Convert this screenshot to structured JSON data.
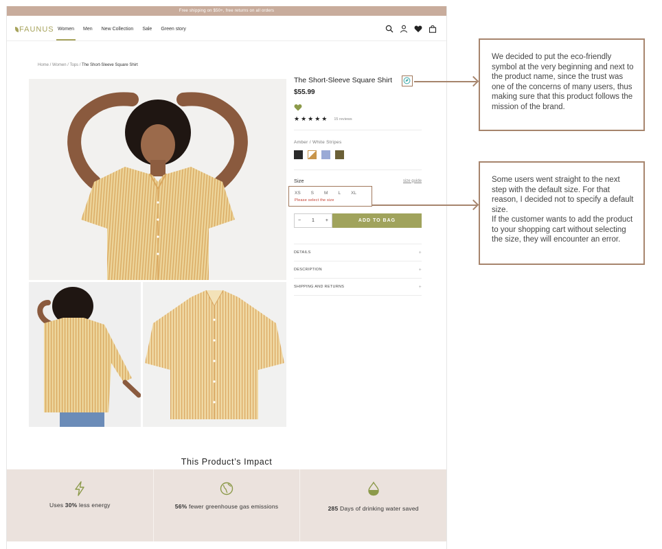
{
  "promo_bar": "Free shipping on $50+, free returns on all orders",
  "brand": "FAUNUS",
  "nav": {
    "links": [
      "Women",
      "Men",
      "New Collection",
      "Sale",
      "Green story"
    ],
    "active": "Women",
    "icons": [
      "search-icon",
      "account-icon",
      "wishlist-heart-icon",
      "bag-icon"
    ]
  },
  "breadcrumb": {
    "trail": "Home / Women / Tops /",
    "current": "The Short-Sleeve Square Shirt"
  },
  "product": {
    "title": "The Short-Sleeve Square Shirt",
    "price": "$55.99",
    "rating_stars": "★★★★★",
    "rating": 5,
    "reviews": "15 reviews",
    "color_label": "Amber / White Stripes",
    "swatches": [
      "#2a2a2a",
      "#c8954a",
      "#9aaad6",
      "#6b6037"
    ],
    "size_title": "Size",
    "size_guide": "size guide",
    "sizes": [
      "XS",
      "S",
      "M",
      "L",
      "XL"
    ],
    "size_error": "Please select the size",
    "qty_minus": "−",
    "qty_value": "1",
    "qty_plus": "+",
    "add_to_bag": "ADD TO BAG",
    "accordion": [
      "DETAILS",
      "DESCRIPTION",
      "SHIPPING AND RETURNS"
    ],
    "accordion_icon": "+"
  },
  "impact": {
    "title": "This Product’s Impact",
    "items": [
      {
        "icon": "lightning-icon",
        "pre": "Uses ",
        "bold": "30%",
        "post": " less energy"
      },
      {
        "icon": "globe-icon",
        "pre": "",
        "bold": "56%",
        "post": " fewer greenhouse gas emissions"
      },
      {
        "icon": "water-drop-icon",
        "pre": "",
        "bold": "285",
        "post": " Days of drinking water saved"
      }
    ]
  },
  "annotations": {
    "note1": "We decided to put the eco-friendly symbol at the very beginning and next to the product name, since the trust was one of the concerns of many users, thus making sure that this product follows the mission of the brand.",
    "note2_line1": "Some users went straight to the next step with the default size. For that reason, I decided not to specify a default size.",
    "note2_line2": "If the customer wants to add the product to your shopping cart without selecting the size, they will encounter an error."
  },
  "colors": {
    "accent_olive": "#a0a35c",
    "promo": "#c8ac9c",
    "impact_bg": "#ebe2dd",
    "annotation_border": "#a6846c",
    "error_red": "#c0392b"
  }
}
